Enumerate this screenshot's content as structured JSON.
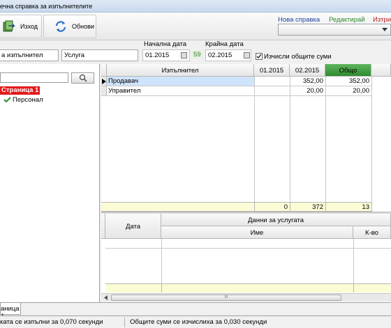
{
  "window": {
    "title": "ечна справка за изпълнителите"
  },
  "toolbar": {
    "exit_label": "Изход",
    "refresh_label": "Обнови",
    "menu": [
      "Нова справка",
      "Редактирай",
      "Изтри"
    ]
  },
  "colors": {
    "new_report": "#1f3f9e",
    "edit": "#2f8a2f",
    "delete": "#b01c1c",
    "selected_row": "#cfe3fb",
    "total_header": "#2e8b2e",
    "totals_row": "#fbfbd6",
    "tree_page": "#e21b1b"
  },
  "filters": {
    "performer_label": "а изпълнител",
    "service_label": "Услуга",
    "start_label": "Начална дата",
    "end_label": "Крайна дата",
    "start_value": "01.2015",
    "day_count": "59",
    "end_value": "02.2015",
    "calc_totals_label": "Изчисли общите суми",
    "calc_totals_checked": true
  },
  "tree": {
    "page": "Страница 1",
    "child": "Персонал"
  },
  "grid": {
    "columns": [
      "Изпълнител",
      "01.2015",
      "02.2015",
      "Общо"
    ],
    "rows": [
      {
        "name": "Продавач",
        "c1": "",
        "c2": "352,00",
        "total": "352,00",
        "selected": true
      },
      {
        "name": "Управител",
        "c1": "",
        "c2": "20,00",
        "total": "20,00",
        "selected": false
      }
    ],
    "totals": [
      "0",
      "372",
      "13"
    ]
  },
  "detail_grid": {
    "col_date": "Дата",
    "group_header": "Данни за услугата",
    "col_name": "Име",
    "col_qty": "К-во",
    "scroll_grip": "III"
  },
  "tabs": [
    "аница 1"
  ],
  "status": {
    "left": "ката се изпълни за 0,070 секунди",
    "right": "Общите суми се изчислиха за 0,030 секунди"
  }
}
